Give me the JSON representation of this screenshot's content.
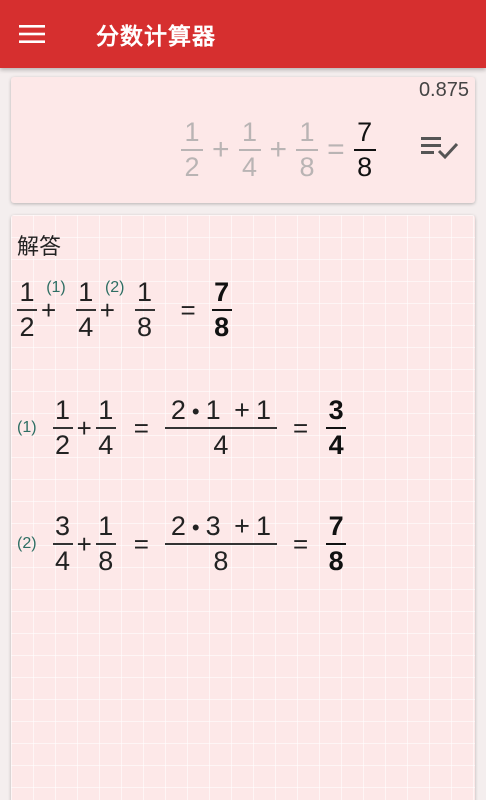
{
  "app": {
    "title": "分数计算器"
  },
  "input": {
    "decimal": "0.875",
    "terms": [
      {
        "num": "1",
        "den": "2"
      },
      {
        "num": "1",
        "den": "4"
      },
      {
        "num": "1",
        "den": "8"
      }
    ],
    "op": "+",
    "equals": "=",
    "result": {
      "num": "7",
      "den": "8"
    }
  },
  "solution": {
    "title": "解答",
    "summary": {
      "terms": [
        {
          "num": "1",
          "den": "2",
          "tag": "(1)"
        },
        {
          "num": "1",
          "den": "4",
          "tag": "(2)"
        },
        {
          "num": "1",
          "den": "8"
        }
      ],
      "op": "+",
      "equals": "=",
      "result": {
        "num": "7",
        "den": "8"
      }
    },
    "steps": [
      {
        "tag": "(1)",
        "a": {
          "num": "1",
          "den": "2"
        },
        "op": "+",
        "b": {
          "num": "1",
          "den": "4"
        },
        "equals": "=",
        "work": {
          "num_a": "2",
          "dot": "•",
          "num_b": "1",
          "plus": "+",
          "num_c": "1",
          "den": "4"
        },
        "result": {
          "num": "3",
          "den": "4"
        }
      },
      {
        "tag": "(2)",
        "a": {
          "num": "3",
          "den": "4"
        },
        "op": "+",
        "b": {
          "num": "1",
          "den": "8"
        },
        "equals": "=",
        "work": {
          "num_a": "2",
          "dot": "•",
          "num_b": "3",
          "plus": "+",
          "num_c": "1",
          "den": "8"
        },
        "result": {
          "num": "7",
          "den": "8"
        }
      }
    ]
  },
  "icons": {
    "menu": "menu-icon",
    "check": "playlist-check-icon"
  },
  "colors": {
    "appbar": "#d62f2f",
    "card": "#fde8e8",
    "tag": "#2e6e63"
  }
}
